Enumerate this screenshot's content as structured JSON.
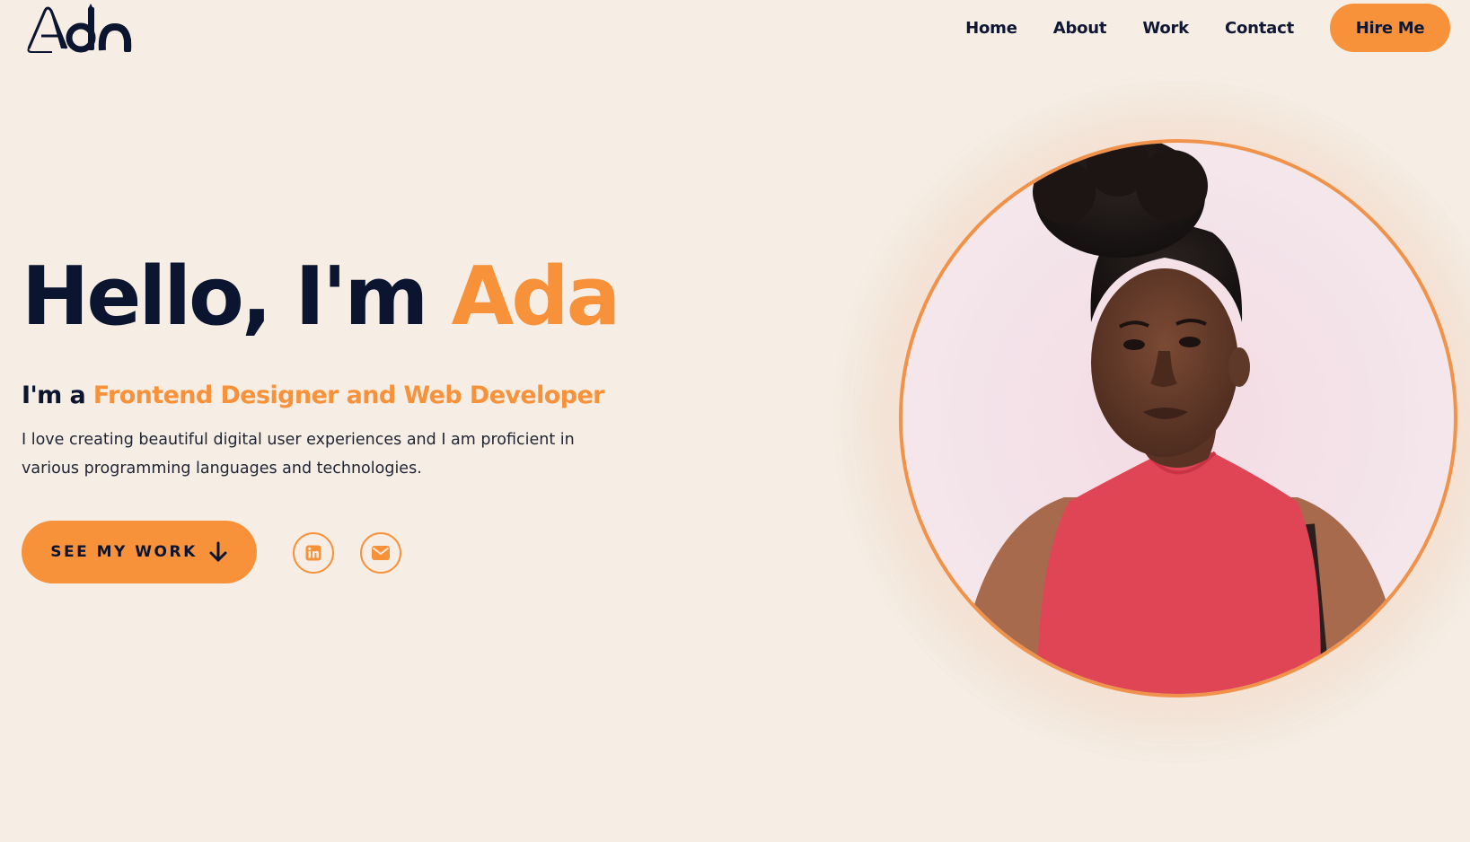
{
  "brand": {
    "logo_text": "Ada"
  },
  "nav": {
    "items": [
      {
        "label": "Home"
      },
      {
        "label": "About"
      },
      {
        "label": "Work"
      },
      {
        "label": "Contact"
      }
    ],
    "cta_label": "Hire Me"
  },
  "hero": {
    "greeting": "Hello, I'm ",
    "name": "Ada",
    "subtitle_prefix": "I'm a ",
    "subtitle_role": "Frontend Designer and Web Developer",
    "description": "I love creating beautiful digital user experiences and I am proficient in various programming languages and technologies.",
    "cta_label": "SEE MY WORK"
  },
  "social": {
    "linkedin_icon": "linkedin-icon",
    "mail_icon": "mail-icon"
  },
  "colors": {
    "accent": "#f7913a",
    "text_dark": "#0c1530",
    "background": "#f6eee5",
    "portrait_ring": "#f0924a",
    "shirt": "#e04555"
  }
}
